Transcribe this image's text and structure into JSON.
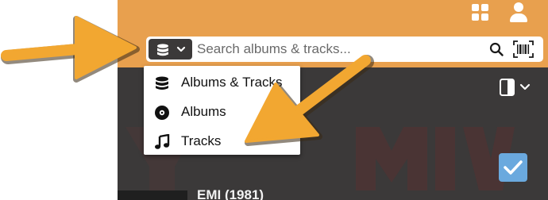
{
  "header": {
    "apps_icon": "grid-icon",
    "account_icon": "user-icon",
    "accent_color": "#e8a04e"
  },
  "search": {
    "source_icon": "database-icon",
    "placeholder": "Search albums & tracks...",
    "value": "",
    "search_icon": "magnifier-icon",
    "scan_icon": "barcode-icon"
  },
  "source_menu": {
    "items": [
      {
        "label": "Albums & Tracks",
        "icon": "database-icon"
      },
      {
        "label": "Albums",
        "icon": "disc-icon"
      },
      {
        "label": "Tracks",
        "icon": "music-note-icon"
      }
    ]
  },
  "content": {
    "album_title": "EMI (1981)",
    "selected": true,
    "check_color": "#6aa9de",
    "view_toggle_icon": "layout-toggle-icon"
  },
  "annotations": {
    "arrow_color": "#f2a731"
  }
}
